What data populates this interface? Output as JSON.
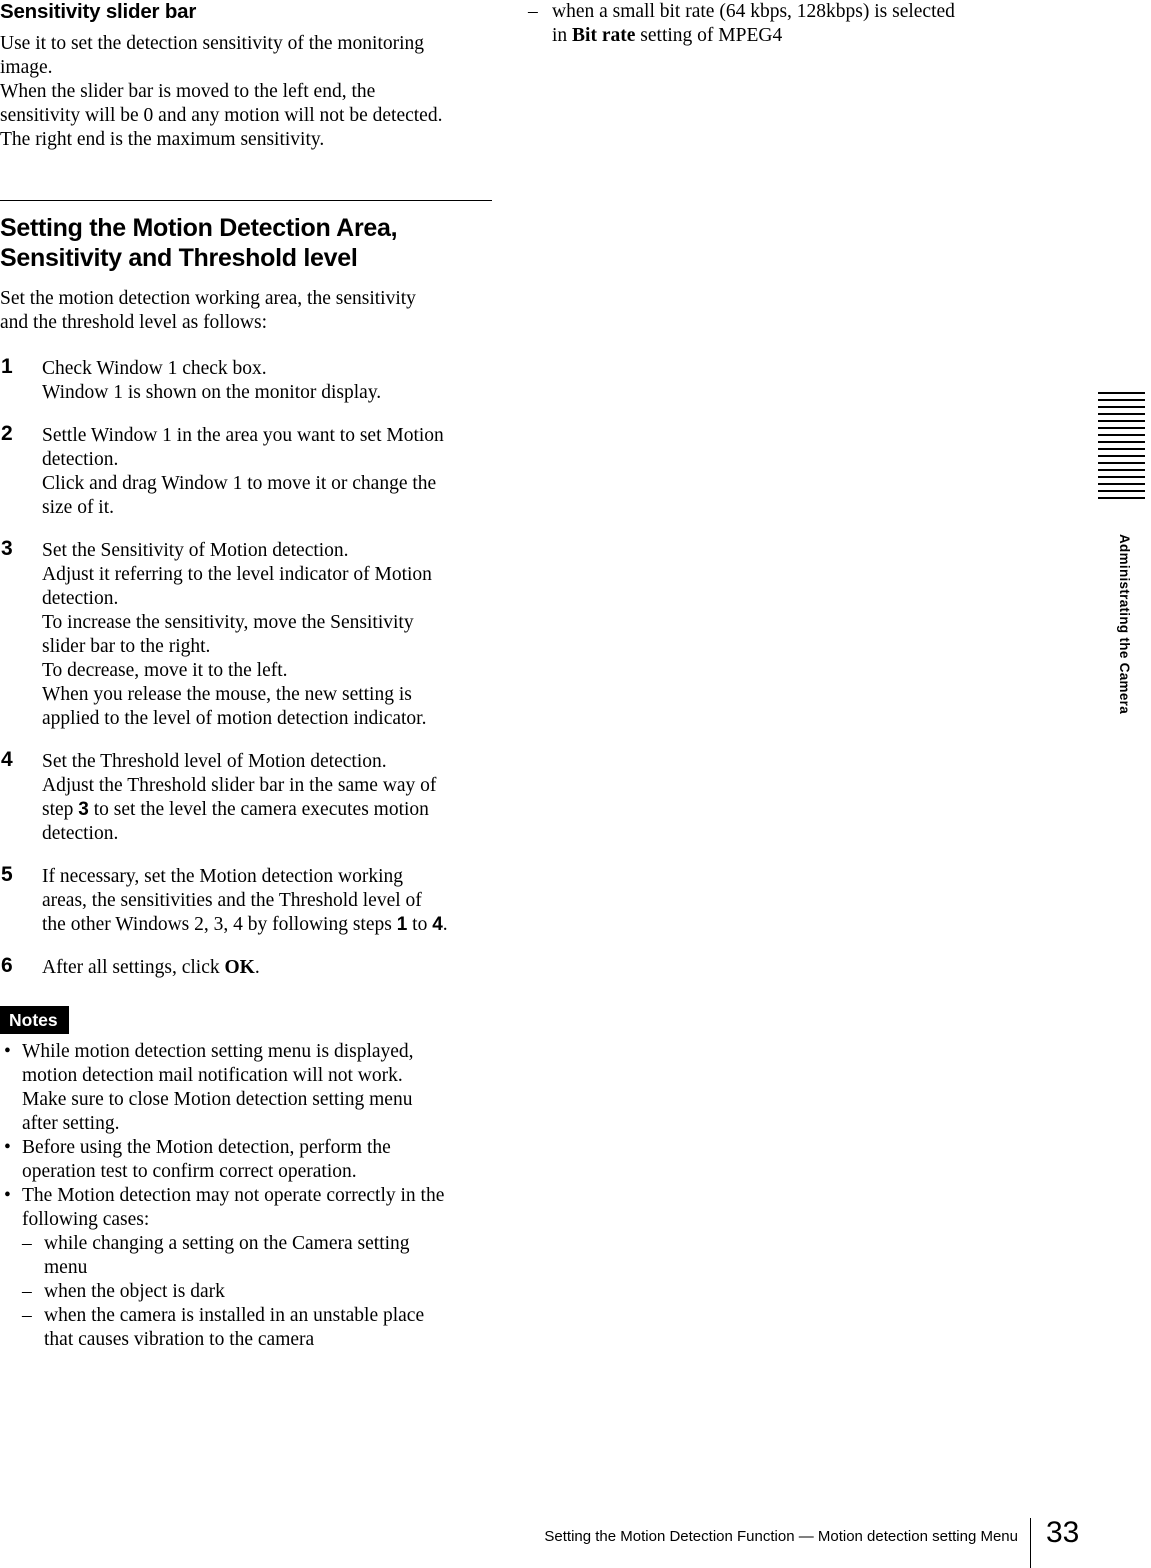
{
  "left_column": {
    "subheading": "Sensitivity slider bar",
    "intro_lines": [
      "Use it to set the detection sensitivity of the monitoring",
      "image.",
      "When the slider bar is moved to the left end, the",
      "sensitivity will be 0 and any motion will not be detected.",
      "The right end is the maximum sensitivity."
    ],
    "main_heading_line1": "Setting the Motion Detection Area,",
    "main_heading_line2": "Sensitivity and Threshold level",
    "main_intro_lines": [
      "Set the motion detection working area, the sensitivity",
      "and the threshold level as follows:"
    ],
    "steps": [
      {
        "number": "1",
        "lines": [
          "Check Window 1 check box.",
          "Window 1 is shown on the monitor display."
        ]
      },
      {
        "number": "2",
        "lines": [
          "Settle Window 1 in the area you want to set Motion",
          "detection.",
          "Click and drag Window 1 to move it or change the",
          "size of it."
        ]
      },
      {
        "number": "3",
        "lines": [
          "Set the Sensitivity of Motion detection.",
          "Adjust it referring to the level indicator of Motion",
          "detection.",
          "To increase the sensitivity, move the Sensitivity",
          "slider bar to the right.",
          "To decrease, move it to the left.",
          "When you release the mouse, the new setting is",
          "applied to the level of motion detection indicator."
        ]
      },
      {
        "number": "4",
        "line1": "Set the Threshold level of Motion detection.",
        "line2": "Adjust the Threshold slider bar in the same way of",
        "line3_pre": "step ",
        "line3_bold": "3",
        "line3_post": " to set the level the camera executes motion",
        "line4": "detection."
      },
      {
        "number": "5",
        "line1": "If necessary, set the Motion detection working",
        "line2": "areas, the sensitivities and the Threshold level of",
        "line3_pre": "the other Windows 2, 3, 4 by following steps ",
        "line3_bold1": "1",
        "line3_mid": " to ",
        "line3_bold2": "4",
        "line3_post": "."
      },
      {
        "number": "6",
        "line1_pre": "After all settings, click ",
        "line1_bold": "OK",
        "line1_post": "."
      }
    ],
    "notes_badge": "Notes",
    "notes": [
      {
        "mark": "•",
        "lines": [
          "While motion detection setting menu is displayed,",
          "motion detection mail notification will not work.",
          "Make sure to close Motion detection setting menu",
          "after setting."
        ]
      },
      {
        "mark": "•",
        "lines": [
          "Before using the Motion detection, perform the",
          "operation test to confirm correct operation."
        ]
      },
      {
        "mark": "•",
        "lines": [
          "The Motion detection may not operate correctly in the",
          "following cases:"
        ]
      }
    ],
    "note_sub_items": [
      {
        "mark": "–",
        "lines": [
          "while changing a setting on the Camera setting",
          "menu"
        ]
      },
      {
        "mark": "–",
        "lines": [
          "when the object is dark"
        ]
      },
      {
        "mark": "–",
        "lines": [
          "when the camera is installed in an unstable place",
          "that causes vibration to the camera"
        ]
      }
    ]
  },
  "right_column": {
    "continued_item": {
      "mark": "–",
      "line1": "when a small bit rate (64 kbps, 128kbps) is selected",
      "line2_pre": "in ",
      "line2_bold": "Bit rate",
      "line2_post": " setting of MPEG4"
    }
  },
  "side_tab": {
    "label": "Administrating the Camera",
    "stripe_count": 16
  },
  "footer": {
    "text": "Setting the Motion Detection Function — Motion detection setting Menu",
    "page_number": "33"
  },
  "colors": {
    "ink": "#000000",
    "paper": "#ffffff"
  }
}
